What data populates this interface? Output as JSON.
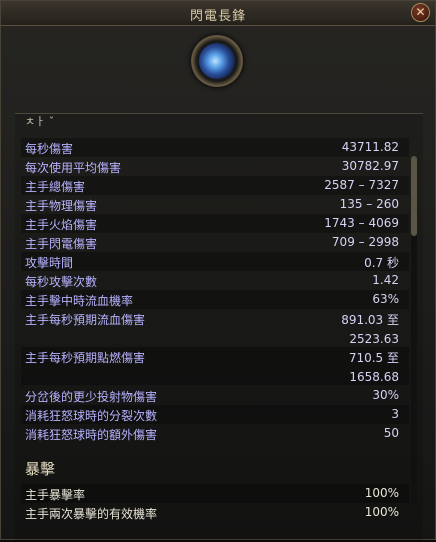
{
  "window": {
    "title": "閃電長鋒",
    "close_label": "✕"
  },
  "panel": {
    "tab_stub": "ㅊㅏ ˇ"
  },
  "stats": [
    {
      "label": "每秒傷害",
      "value": "43711.82"
    },
    {
      "label": "每次使用平均傷害",
      "value": "30782.97"
    },
    {
      "label": "主手總傷害",
      "value": "2587 – 7327"
    },
    {
      "label": "主手物理傷害",
      "value": "135 – 260"
    },
    {
      "label": "主手火焰傷害",
      "value": "1743 – 4069"
    },
    {
      "label": "主手閃電傷害",
      "value": "709 – 2998"
    },
    {
      "label": "攻擊時間",
      "value": "0.7 秒"
    },
    {
      "label": "每秒攻擊次數",
      "value": "1.42"
    },
    {
      "label": "主手擊中時流血機率",
      "value": "63%"
    },
    {
      "label": "主手每秒預期流血傷害",
      "value": "891.03 至",
      "value2": "2523.63"
    },
    {
      "label": "主手每秒預期點燃傷害",
      "value": "710.5 至",
      "value2": "1658.68"
    },
    {
      "label": "分岔後的更少投射物傷害",
      "value": "30%"
    },
    {
      "label": "消耗狂怒球時的分裂次數",
      "value": "3"
    },
    {
      "label": "消耗狂怒球時的額外傷害",
      "value": "50"
    }
  ],
  "crit_section": {
    "title": "暴擊",
    "rows": [
      {
        "label": "主手暴擊率",
        "value": "100%"
      },
      {
        "label": "主手兩次暴擊的有效機率",
        "value": "100%"
      }
    ]
  }
}
